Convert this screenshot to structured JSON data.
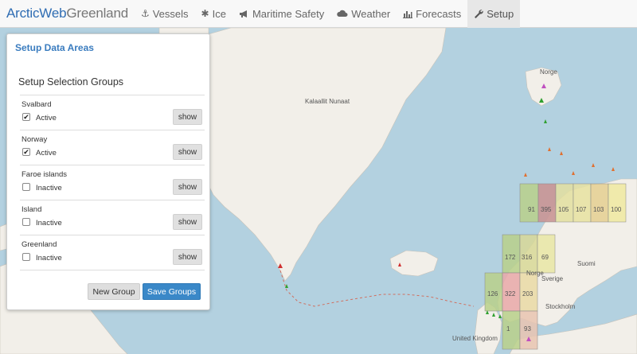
{
  "nav": {
    "brand_part1": "ArcticWeb",
    "brand_part2": "Greenland",
    "items": [
      {
        "label": "Vessels",
        "icon": "anchor-icon"
      },
      {
        "label": "Ice",
        "icon": "snowflake-icon"
      },
      {
        "label": "Maritime Safety",
        "icon": "bullhorn-icon"
      },
      {
        "label": "Weather",
        "icon": "cloud-icon"
      },
      {
        "label": "Forecasts",
        "icon": "bar-chart-icon"
      },
      {
        "label": "Setup",
        "icon": "wrench-icon",
        "active": true
      }
    ]
  },
  "panel": {
    "title": "Setup Data Areas",
    "subtitle": "Setup Selection Groups",
    "groups": [
      {
        "name": "Svalbard",
        "state": "Active",
        "checked": true,
        "button": "show"
      },
      {
        "name": "Norway",
        "state": "Active",
        "checked": true,
        "button": "show"
      },
      {
        "name": "Faroe islands",
        "state": "Inactive",
        "checked": false,
        "button": "show"
      },
      {
        "name": "Island",
        "state": "Inactive",
        "checked": false,
        "button": "show"
      },
      {
        "name": "Greenland",
        "state": "Inactive",
        "checked": false,
        "button": "show"
      }
    ],
    "new_group_label": "New Group",
    "save_groups_label": "Save Groups"
  },
  "map": {
    "labels": {
      "greenland": "Kalaallit Nunaat",
      "norge_north": "Norge",
      "norge": "Norge",
      "suomi": "Suomi",
      "sverige": "Sverige",
      "stockholm": "Stockholm",
      "uk": "United Kingdom"
    },
    "grid_cells": [
      "91",
      "395",
      "105",
      "107",
      "103",
      "100",
      "172",
      "316",
      "69",
      "126",
      "322",
      "203",
      "1",
      "93"
    ],
    "colors": {
      "land": "#f2efe9",
      "sea": "#b3d1e0",
      "cell_green": "#b9d08a",
      "cell_yellow": "#f0e9a0",
      "cell_red": "#e59a9a",
      "accent": "#3a88c8"
    }
  }
}
